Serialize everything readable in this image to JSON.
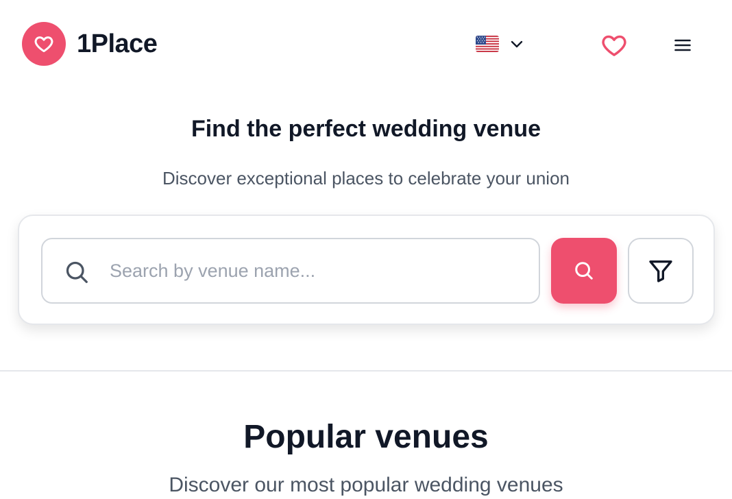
{
  "header": {
    "brand_name": "1Place",
    "language_flag": "us-flag",
    "colors": {
      "brand": "#ee4f6e"
    }
  },
  "hero": {
    "title": "Find the perfect wedding venue",
    "subtitle": "Discover exceptional places to celebrate your union"
  },
  "search": {
    "placeholder": "Search by venue name...",
    "value": ""
  },
  "popular": {
    "title": "Popular venues",
    "subtitle": "Discover our most popular wedding venues"
  },
  "icons": {
    "logo": "heart-icon",
    "language_dropdown": "chevron-down-icon",
    "favorites": "heart-outline-icon",
    "menu": "hamburger-icon",
    "search_field": "search-icon",
    "search_button": "search-icon",
    "filter": "filter-icon"
  }
}
